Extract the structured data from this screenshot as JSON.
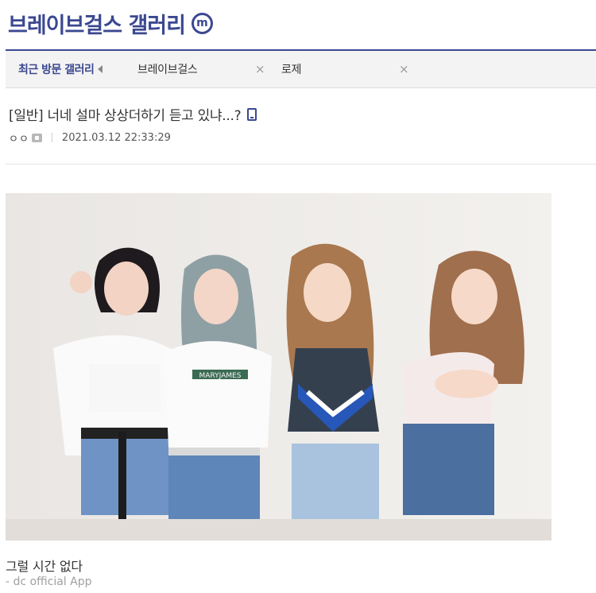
{
  "gallery": {
    "title": "브레이브걸스 갤러리",
    "badge": "m"
  },
  "recent": {
    "label": "최근 방문 갤러리",
    "items": [
      {
        "name": "브레이브걸스",
        "close": "×"
      },
      {
        "name": "로제",
        "close": "×"
      }
    ]
  },
  "post": {
    "title": "[일반] 너네 설마 상상더하기 듣고 있냐...?",
    "writer": "ㅇㅇ",
    "date": "2021.03.12 22:33:29",
    "body": "그럴 시간 없다",
    "signature": "- dc official App"
  },
  "photo": {
    "shirt_text": "MARYJAMES"
  },
  "colors": {
    "accent": "#3b4890",
    "bar_bg": "#f3f3f3"
  }
}
